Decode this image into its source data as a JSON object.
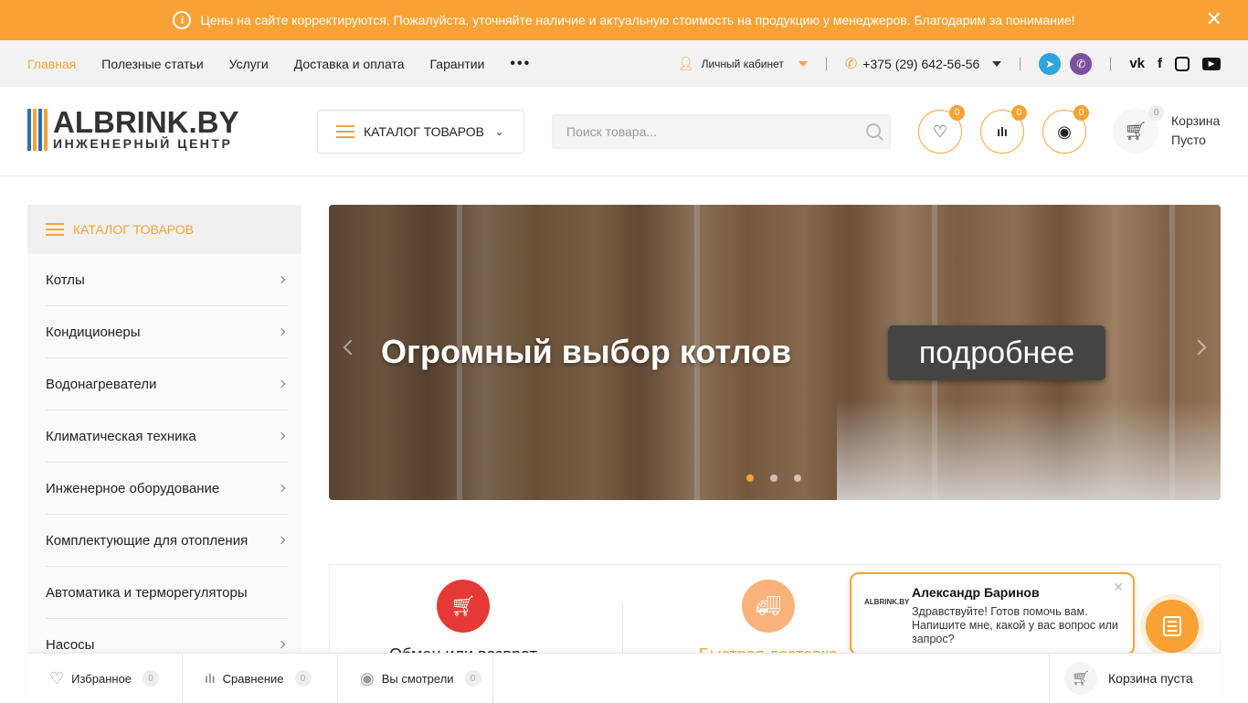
{
  "notice": {
    "text": "Цены на сайте корректируются. Пожалуйста, уточняйте наличие и актуальную стоимость на продукцию у менеджеров. Благодарим за понимание!",
    "icon": "info-icon"
  },
  "topnav": {
    "items": [
      {
        "label": "Главная",
        "active": true
      },
      {
        "label": "Полезные статьи"
      },
      {
        "label": "Услуги"
      },
      {
        "label": "Доставка и оплата"
      },
      {
        "label": "Гарантии"
      }
    ],
    "more": "•••"
  },
  "account": {
    "label": "Личный кабинет"
  },
  "phone": {
    "number": "+375 (29) 642-56-56"
  },
  "messengers": [
    {
      "icon": "telegram-icon",
      "color": "#2ca5e0"
    },
    {
      "icon": "viber-icon",
      "color": "#7b519d"
    }
  ],
  "socials": [
    "vk-icon",
    "facebook-icon",
    "instagram-icon",
    "youtube-icon"
  ],
  "logo": {
    "main": "ALBRINK.BY",
    "sub": "ИНЖЕНЕРНЫЙ ЦЕНТР",
    "bar_colors": [
      "#2a6fb5",
      "#f8a235",
      "#2a6fb5",
      "#f8a235"
    ]
  },
  "header": {
    "catalog_label": "КАТАЛОГ ТОВАРОВ",
    "search_placeholder": "Поиск товара...",
    "favorites_count": "0",
    "compare_count": "0",
    "viewed_count": "0",
    "cart_count": "0",
    "cart_title": "Корзина",
    "cart_status": "Пусто"
  },
  "sidebar": {
    "title": "КАТАЛОГ ТОВАРОВ",
    "items": [
      {
        "label": "Котлы",
        "has_sub": true
      },
      {
        "label": "Кондиционеры",
        "has_sub": true
      },
      {
        "label": "Водонагреватели",
        "has_sub": true
      },
      {
        "label": "Климатическая техника",
        "has_sub": true
      },
      {
        "label": "Инженерное оборудование",
        "has_sub": true
      },
      {
        "label": "Комплектующие для отопления",
        "has_sub": true
      },
      {
        "label": "Автоматика и терморегуляторы",
        "has_sub": false
      },
      {
        "label": "Насосы",
        "has_sub": true
      }
    ]
  },
  "slider": {
    "headline": "Огромный выбор котлов",
    "button": "подробнее",
    "dots": 3,
    "active_dot": 0
  },
  "features": [
    {
      "title": "Обмен или возврат",
      "color": "#e53935",
      "icon": "cart-icon"
    },
    {
      "title": "Быстрая доставка",
      "color": "#f9b27a",
      "icon": "truck-icon"
    }
  ],
  "chat": {
    "name": "Александр Баринов",
    "message": "Здравствуйте! Готов помочь вам. Напишите мне, какой у вас вопрос или запрос?",
    "avatar_text": "ALBRINK.BY"
  },
  "bottombar": {
    "favorites": {
      "label": "Избранное",
      "count": "0"
    },
    "compare": {
      "label": "Сравнение",
      "count": "0"
    },
    "viewed": {
      "label": "Вы смотрели",
      "count": "0"
    },
    "cart": {
      "label": "Корзина пуста"
    }
  },
  "colors": {
    "accent": "#f8a235",
    "text": "#222222"
  }
}
